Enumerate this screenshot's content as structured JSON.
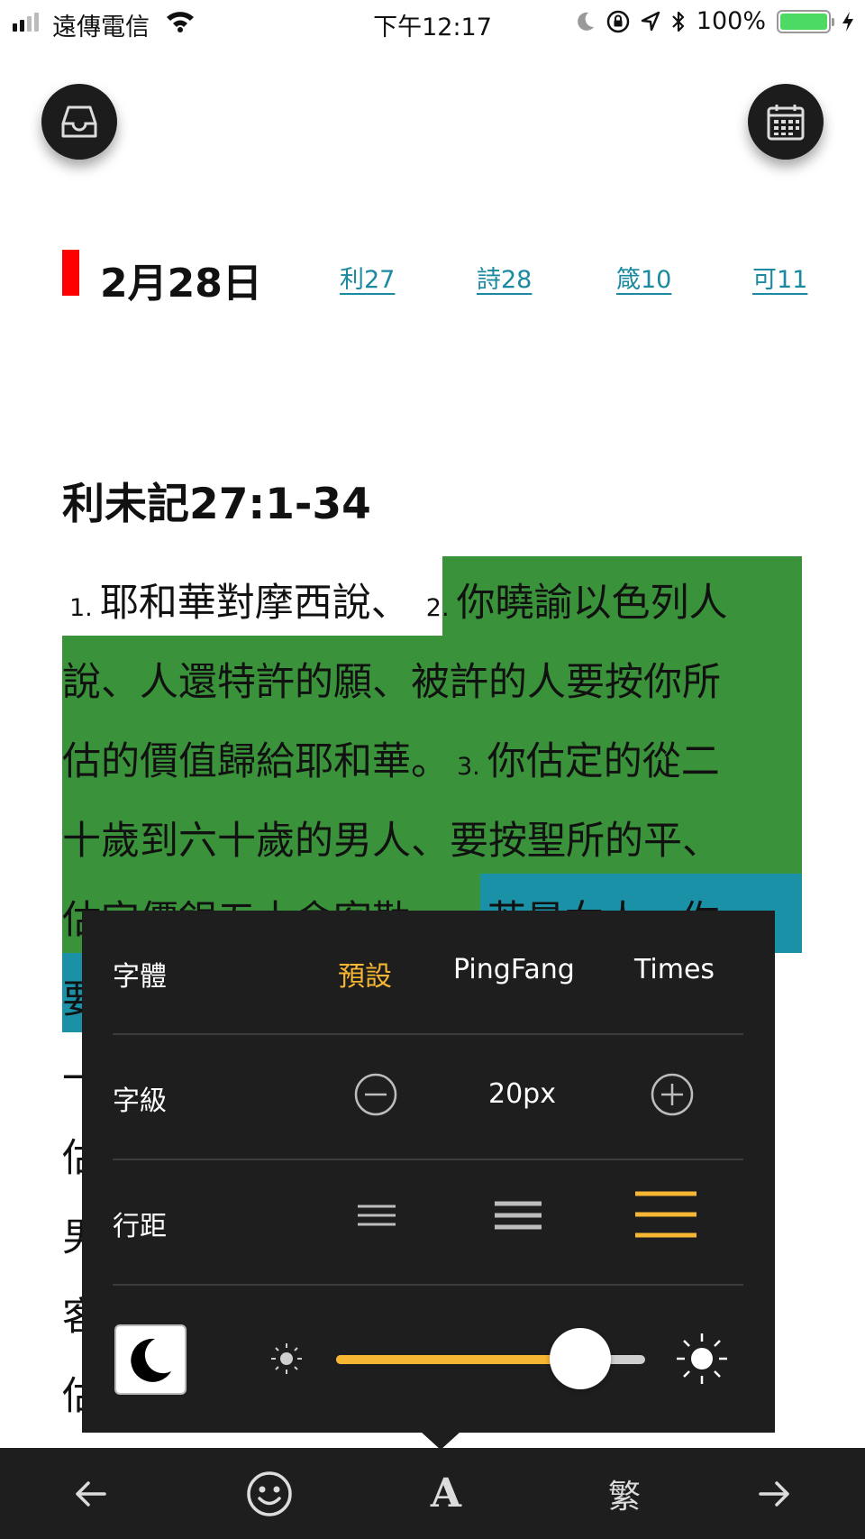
{
  "status_bar": {
    "carrier": "遠傳電信",
    "time": "下午12:17",
    "battery": "100%"
  },
  "buttons": {
    "inbox_icon": "inbox-icon",
    "calendar_icon": "calendar-icon"
  },
  "header": {
    "date": "2月28日",
    "refs": [
      "利27",
      "詩28",
      "箴10",
      "可11"
    ],
    "marker_color": "#ff0000",
    "link_color": "#1b8aa0"
  },
  "passage": {
    "title": "利未記27:1-34",
    "line1_v1_num": "1.",
    "line1_v1_text": "耶和華對摩西說、",
    "line1_v2_num": "2.",
    "line1_v2_text": "你曉諭以色列人",
    "line2": "說、人還特許的願、被許的人要按你所",
    "line3_text": "估的價值歸給耶和華。",
    "line3_v3_num": "3.",
    "line3_v3_text": "你估定的從二",
    "line4": "十歲到六十歲的男人、要按聖所的平、",
    "line5_text": "估定價銀五十舍客勒。",
    "line5_v4_num": "4.",
    "line5_v4_text": "若是女人、你",
    "line6": "要",
    "line7": "一",
    "line8": "估",
    "line9": "男",
    "line10": "客",
    "line11": "估",
    "highlight_green": "#3a923a",
    "highlight_teal": "#1b91a8"
  },
  "settings": {
    "font_label": "字體",
    "font_options": [
      "預設",
      "PingFang",
      "Times"
    ],
    "font_selected": "預設",
    "size_label": "字級",
    "size_value": "20px",
    "line_label": "行距",
    "line_selected": "wide",
    "brightness": 0.79,
    "accent_color": "#f7b733"
  },
  "toolbar": {
    "back_icon": "arrow-left-icon",
    "emoji_icon": "smiley-icon",
    "font_label": "A",
    "trad_label": "繁",
    "forward_icon": "arrow-right-icon"
  }
}
